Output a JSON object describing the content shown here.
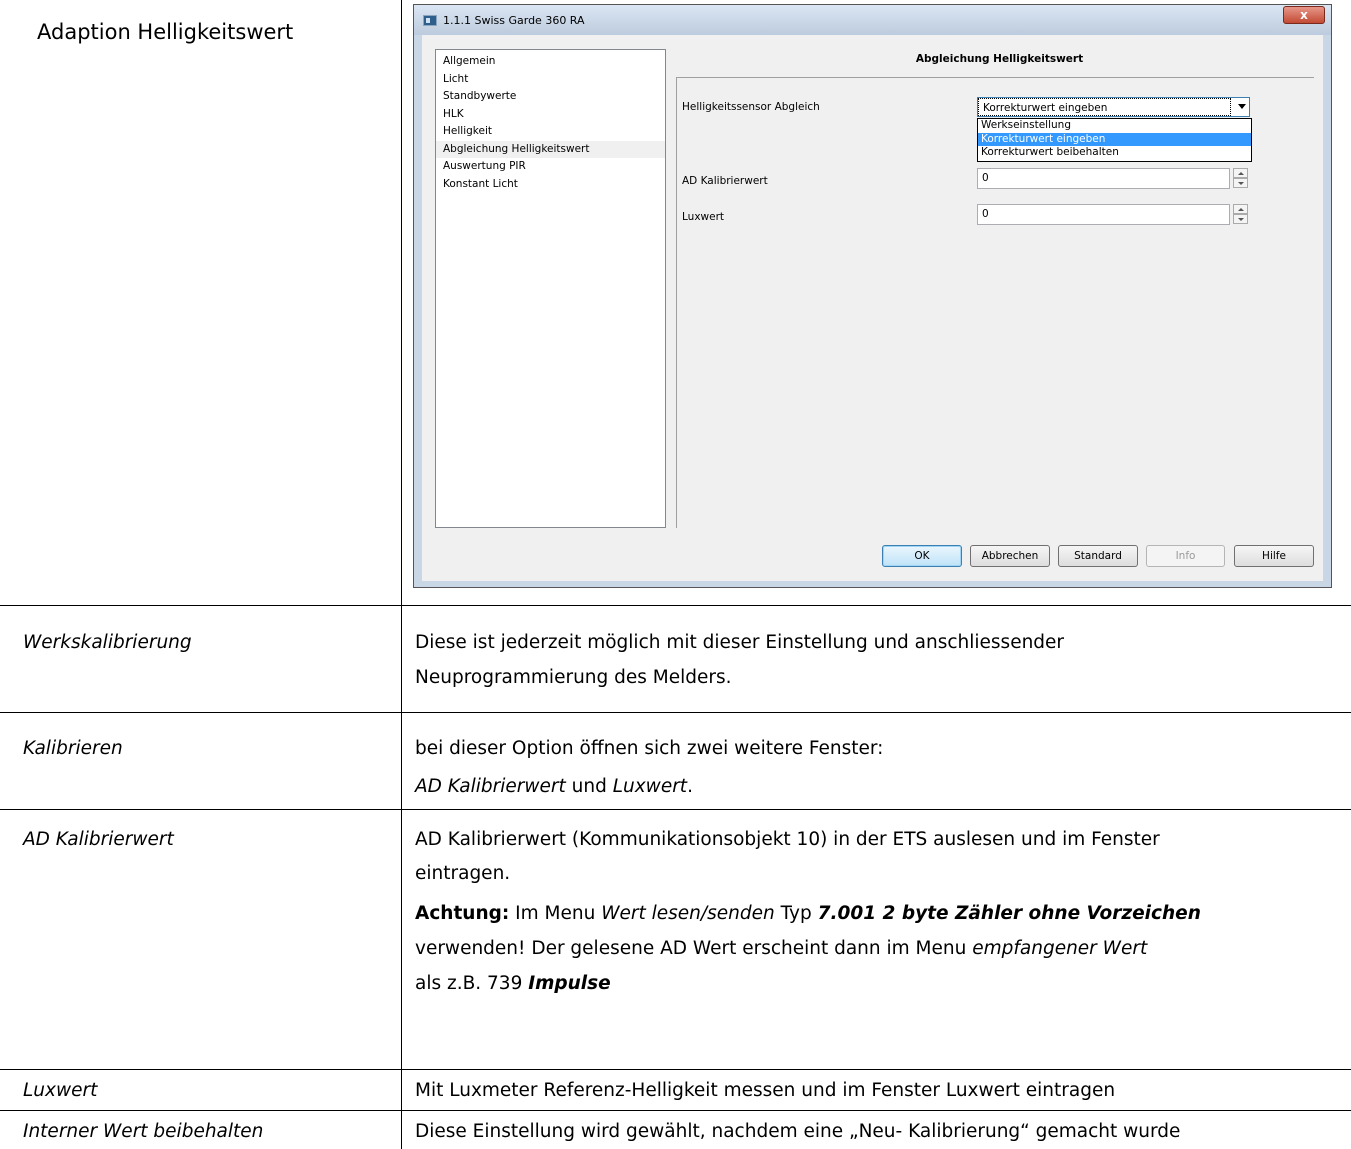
{
  "document": {
    "title": "Adaption Helligkeitswert",
    "rows": [
      {
        "label": "Werkskalibrierung",
        "lines": [
          "Diese ist jederzeit möglich mit dieser Einstellung und anschliessender",
          "Neuprogrammierung des Melders."
        ]
      },
      {
        "label": "Kalibrieren",
        "line1": "bei dieser Option öffnen sich zwei weitere Fenster:",
        "line2_a": "AD Kalibrierwert",
        "line2_b": " und ",
        "line2_c": "Luxwert",
        "line2_d": "."
      },
      {
        "label": "AD Kalibrierwert",
        "line1": " AD Kalibrierwert (Kommunikationsobjekt 10) in der ETS auslesen und im Fenster",
        "line2": "eintragen.",
        "note_bold": "Achtung:",
        "note_a": " Im Menu  ",
        "note_menu": "Wert lesen/senden",
        "note_b": "  Typ  ",
        "note_type": "7.001 2 byte Zähler ohne Vorzeichen",
        "line4_a": "verwenden! Der gelesene AD Wert erscheint dann im Menu ",
        "line4_b": "empfangener Wert",
        "line5_a": "als  z.B.  739  ",
        "line5_b": "Impulse"
      },
      {
        "label": "Luxwert",
        "line1": "Mit Luxmeter Referenz-Helligkeit messen und im Fenster Luxwert  eintragen"
      },
      {
        "label": "Interner Wert beibehalten",
        "line1": "Diese Einstellung wird gewählt, nachdem eine „Neu- Kalibrierung“ gemacht wurde"
      }
    ]
  },
  "dialog": {
    "window_title": "1.1.1 Swiss Garde 360 RA",
    "close_glyph": "x",
    "tree_items": [
      "Allgemein",
      "Licht",
      "Standbywerte",
      "HLK",
      "Helligkeit",
      "Abgleichung Helligkeitswert",
      "Auswertung PIR",
      "Konstant Licht"
    ],
    "selected_tree_item": "Abgleichung Helligkeitswert",
    "panel_title": "Abgleichung Helligkeitswert",
    "params": {
      "sensor_label": "Helligkeitssensor Abgleich",
      "sensor_value": "Korrekturwert eingeben",
      "sensor_options": [
        "Werkseinstellung",
        "Korrekturwert eingeben",
        "Korrekturwert beibehalten"
      ],
      "ad_label": "AD Kalibrierwert",
      "ad_value": "0",
      "lux_label": "Luxwert",
      "lux_value": "0"
    },
    "buttons": {
      "ok": "OK",
      "cancel": "Abbrechen",
      "standard": "Standard",
      "info": "Info",
      "help": "Hilfe"
    }
  }
}
